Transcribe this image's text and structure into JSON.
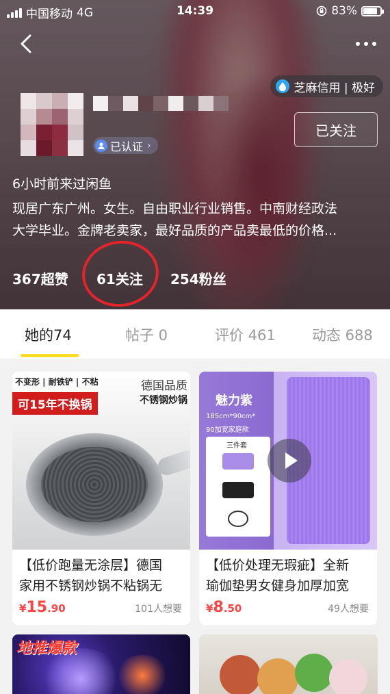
{
  "status_bar": {
    "carrier": "中国移动",
    "network": "4G",
    "time": "14:39",
    "battery_percent": "83%",
    "battery_level": 0.83
  },
  "profile": {
    "sesame_badge": "芝麻信用 | 极好",
    "verified_label": "已认证",
    "follow_button": "已关注",
    "visited": "6小时前来过闲鱼",
    "bio_lines": [
      "现居广东广州。女生。自由职业行业销售。中南财经政法",
      "大学毕业。金牌老卖家，最好品质的产品卖最低的价格..."
    ],
    "stats": [
      "367超赞",
      "61关注",
      "254粉丝"
    ]
  },
  "tabs": [
    {
      "label": "她的74",
      "active": true
    },
    {
      "label": "帖子 0",
      "active": false
    },
    {
      "label": "评价 461",
      "active": false
    },
    {
      "label": "动态 688",
      "active": false
    }
  ],
  "products": [
    {
      "title_lines": [
        "【低价跑量无涂层】德国",
        "家用不锈钢炒锅不粘锅无"
      ],
      "price_currency": "¥",
      "price_int": "15",
      "price_dec": ".90",
      "wants": "101人想要",
      "image_text": {
        "tag1": "不变形 | 耐铁铲 | 不粘",
        "tag2": "可15年不换锅",
        "brand1": "德国品质",
        "brand2": "不锈钢炒锅"
      }
    },
    {
      "title_lines": [
        "【低价处理无瑕疵】全新",
        "瑜伽垫男女健身加厚加宽"
      ],
      "price_currency": "¥",
      "price_int": "8",
      "price_dec": ".50",
      "wants": "49人想要",
      "image_text": {
        "title": "魅力紫",
        "sub1": "185cm*90cm*",
        "sub2": "90加宽家庭款",
        "box_label": "三件套"
      }
    }
  ],
  "preview_text": "地推爆款",
  "colors": {
    "accent_yellow": "#ffda22",
    "price_red": "#ff4444",
    "annotation_red": "#e3242b"
  }
}
